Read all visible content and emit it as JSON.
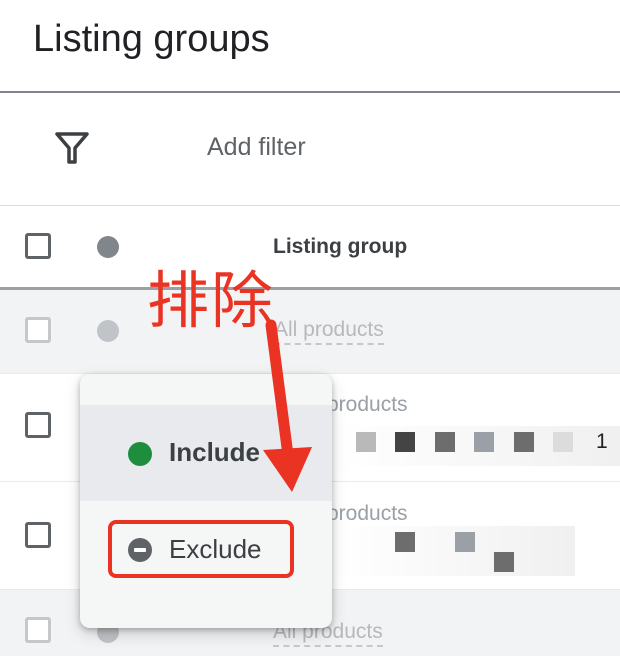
{
  "header": {
    "title": "Listing groups"
  },
  "toolbar": {
    "filter_icon": "filter-icon",
    "add_filter_label": "Add filter"
  },
  "table": {
    "column_header": "Listing group",
    "rows": [
      {
        "label": "All products"
      },
      {
        "label": "products",
        "suffix": "1"
      },
      {
        "label": "products"
      },
      {
        "label": "All products"
      }
    ]
  },
  "status_menu": {
    "items": [
      {
        "label": "Include",
        "icon": "green-dot-icon",
        "color": "#1e8e3e"
      },
      {
        "label": "Exclude",
        "icon": "exclude-icon",
        "color": "#5f6368"
      }
    ]
  },
  "annotation": {
    "text": "排除",
    "color": "#ea3323"
  }
}
